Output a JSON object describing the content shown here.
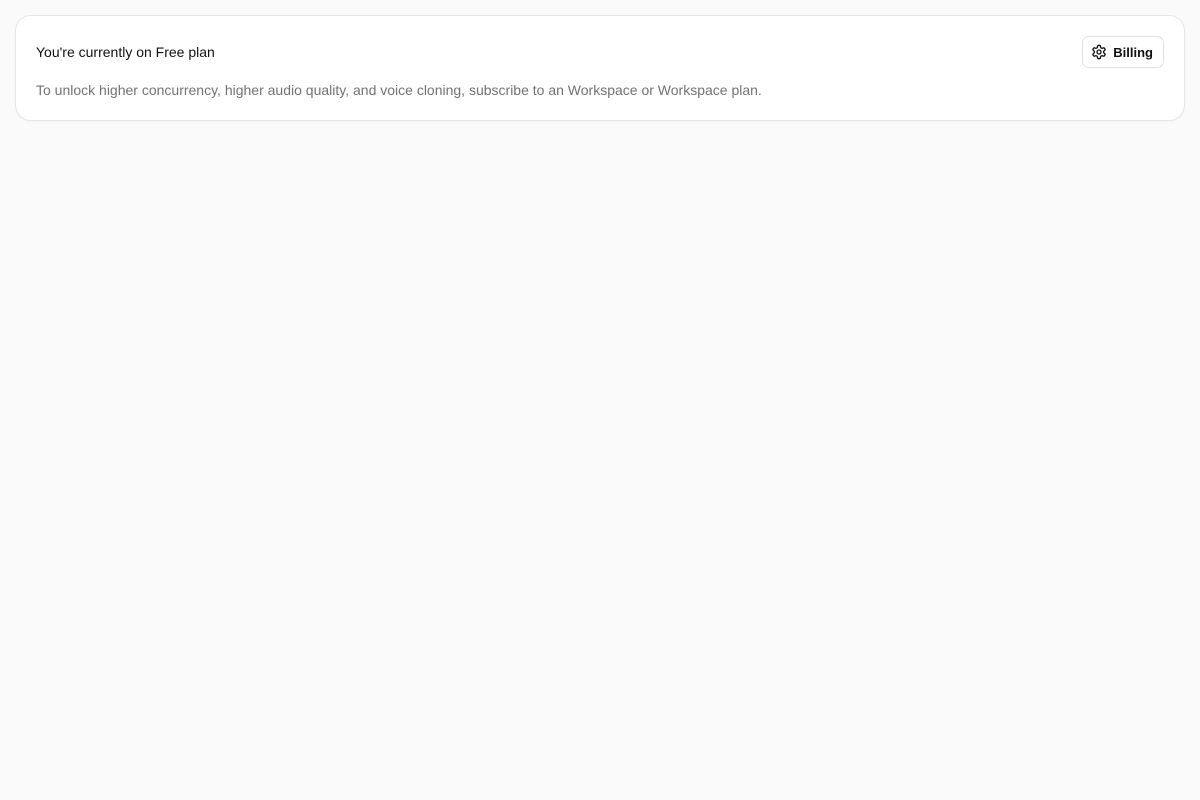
{
  "plan_card": {
    "title": "You're currently on Free plan",
    "description": "To unlock higher concurrency, higher audio quality, and voice cloning, subscribe to an Workspace or Workspace plan.",
    "billing_button": {
      "label": "Billing",
      "icon": "gear-icon"
    }
  },
  "colors": {
    "page_background": "#fafafa",
    "card_background": "#ffffff",
    "card_border": "#e5e5e5",
    "title_text": "#111111",
    "description_text": "#737373"
  }
}
